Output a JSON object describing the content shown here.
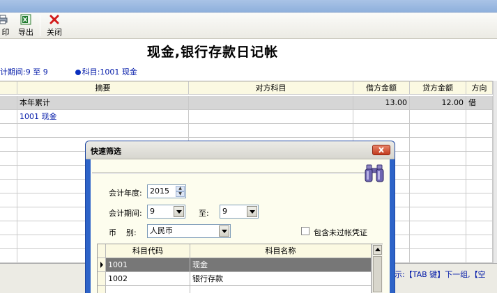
{
  "toolbar": {
    "print_label": "印",
    "export_label": "导出",
    "close_label": "关闭"
  },
  "report": {
    "title": "现金,银行存款日记帐"
  },
  "infobar": {
    "period_text": "计期间:9  至  9",
    "account_text": "科目:1001 现金"
  },
  "grid": {
    "headers": [
      "摘要",
      "对方科目",
      "借方金额",
      "贷方金额",
      "方向"
    ],
    "rows": [
      {
        "summary": "本年累计",
        "counter": "",
        "debit": "13.00",
        "credit": "12.00",
        "dir": "借"
      },
      {
        "summary": "1001 现金",
        "counter": "",
        "debit": "",
        "credit": "",
        "dir": ""
      }
    ]
  },
  "status": {
    "hint": "示:【TAB 键】下一组,【空"
  },
  "dialog": {
    "title": "快速筛选",
    "year_label": "会计年度:",
    "year_value": "2015",
    "period_label": "会计期间:",
    "period_from": "9",
    "period_to_label": "至:",
    "period_to": "9",
    "currency_label": "币    别:",
    "currency_value": "人民币",
    "include_unposted_label": "包含未过帐凭证",
    "include_unposted_checked": false,
    "table": {
      "headers": [
        "科目代码",
        "科目名称"
      ],
      "rows": [
        {
          "code": "1001",
          "name": "现金",
          "selected": true
        },
        {
          "code": "1002",
          "name": "银行存款",
          "selected": false
        }
      ]
    }
  },
  "colors": {
    "title_blue": "#0018a8",
    "dialog_frame": "#2d63c8",
    "header_bg": "#fbf9e2",
    "summary_row_bg": "#d6d6d6"
  }
}
